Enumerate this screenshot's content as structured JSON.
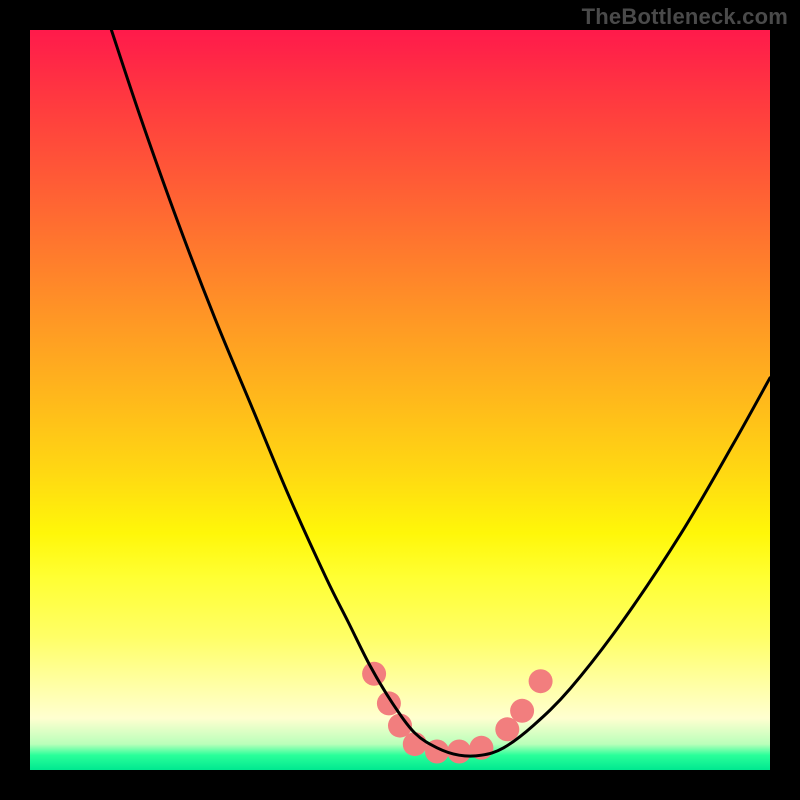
{
  "watermark": {
    "text": "TheBottleneck.com"
  },
  "chart_data": {
    "type": "line",
    "title": "",
    "xlabel": "",
    "ylabel": "",
    "xlim": [
      0,
      100
    ],
    "ylim": [
      0,
      100
    ],
    "gradient_stops": [
      {
        "pos": 0,
        "color": "#ff1a4b"
      },
      {
        "pos": 10,
        "color": "#ff3b3f"
      },
      {
        "pos": 20,
        "color": "#ff5a36"
      },
      {
        "pos": 30,
        "color": "#ff7a2d"
      },
      {
        "pos": 40,
        "color": "#ff9a24"
      },
      {
        "pos": 50,
        "color": "#ffb91b"
      },
      {
        "pos": 60,
        "color": "#ffd912"
      },
      {
        "pos": 68,
        "color": "#fff709"
      },
      {
        "pos": 74,
        "color": "#ffff33"
      },
      {
        "pos": 82,
        "color": "#ffff66"
      },
      {
        "pos": 88,
        "color": "#ffffa0"
      },
      {
        "pos": 93,
        "color": "#ffffd0"
      },
      {
        "pos": 96.5,
        "color": "#baffba"
      },
      {
        "pos": 98,
        "color": "#2aff9a"
      },
      {
        "pos": 100,
        "color": "#00e890"
      }
    ],
    "series": [
      {
        "name": "bottleneck-curve",
        "color": "#000000",
        "x": [
          11,
          15,
          20,
          25,
          30,
          35,
          40,
          43,
          46,
          49,
          52,
          55,
          58,
          61,
          64,
          68,
          73,
          80,
          88,
          95,
          100
        ],
        "values": [
          100,
          88,
          74,
          61,
          49,
          37,
          26,
          20,
          14,
          9,
          5,
          3,
          2,
          2,
          3,
          6,
          11,
          20,
          32,
          44,
          53
        ]
      }
    ],
    "markers": {
      "name": "highlight-dots",
      "color": "#f27e7e",
      "radius": 12,
      "points": [
        {
          "x": 46.5,
          "y": 13
        },
        {
          "x": 48.5,
          "y": 9
        },
        {
          "x": 50,
          "y": 6
        },
        {
          "x": 52,
          "y": 3.5
        },
        {
          "x": 55,
          "y": 2.5
        },
        {
          "x": 58,
          "y": 2.5
        },
        {
          "x": 61,
          "y": 3
        },
        {
          "x": 64.5,
          "y": 5.5
        },
        {
          "x": 66.5,
          "y": 8
        },
        {
          "x": 69,
          "y": 12
        }
      ]
    }
  }
}
